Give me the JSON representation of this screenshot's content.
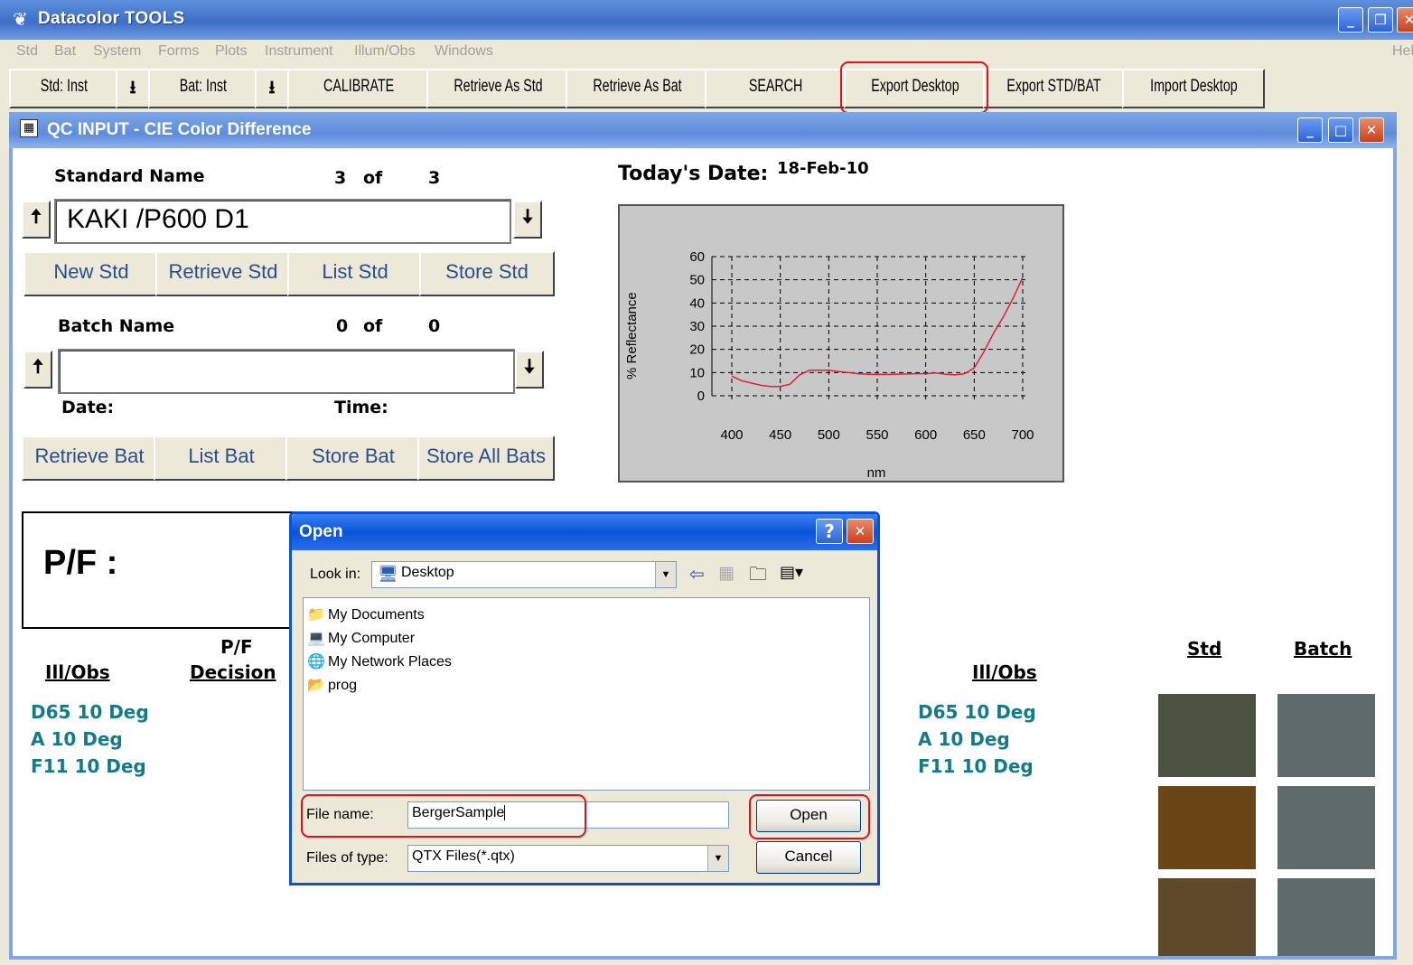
{
  "app": {
    "title": "Datacolor TOOLS",
    "help_fragment": "Hel"
  },
  "menu": [
    "Std",
    "Bat",
    "System",
    "Forms",
    "Plots",
    "Instrument",
    "Illum/Obs",
    "Windows"
  ],
  "toolbar": {
    "std_inst": "Std: Inst",
    "bat_inst": "Bat: Inst",
    "calibrate": "CALIBRATE",
    "retrieve_as_std": "Retrieve As Std",
    "retrieve_as_bat": "Retrieve As Bat",
    "search": "SEARCH",
    "export_desktop": "Export Desktop",
    "export_std_bat": "Export STD/BAT",
    "import_desktop": "Import Desktop"
  },
  "window": {
    "title": "QC INPUT - CIE Color Difference"
  },
  "standard": {
    "label": "Standard Name",
    "index": "3",
    "of": "of",
    "total": "3",
    "value": "KAKI /P600 D1",
    "buttons": [
      "New Std",
      "Retrieve Std",
      "List Std",
      "Store Std"
    ]
  },
  "batch": {
    "label": "Batch Name",
    "index": "0",
    "of": "of",
    "total": "0",
    "value": "",
    "date_label": "Date:",
    "time_label": "Time:",
    "buttons": [
      "Retrieve Bat",
      "List Bat",
      "Store Bat",
      "Store All Bats"
    ]
  },
  "today": {
    "label": "Today's Date:",
    "value": "18-Feb-10"
  },
  "pf": {
    "label": "P/F :"
  },
  "left_table": {
    "col1": "Ill/Obs",
    "col2_line1": "P/F",
    "col2_line2": "Decision",
    "rows": [
      "D65 10 Deg",
      "A 10 Deg",
      "F11 10 Deg"
    ]
  },
  "right_table": {
    "col1": "Ill/Obs",
    "std": "Std",
    "batch": "Batch",
    "rows": [
      "D65 10 Deg",
      "A 10 Deg",
      "F11 10 Deg"
    ]
  },
  "swatches": {
    "std": [
      "#4b5240",
      "#6a4616",
      "#5e4a2a"
    ],
    "batch": [
      "#5f6b6b",
      "#5f6b6b",
      "#5f6b6b"
    ]
  },
  "dialog": {
    "title": "Open",
    "look_in_label": "Look in:",
    "look_in_value": "Desktop",
    "items": [
      "My Documents",
      "My Computer",
      "My Network Places",
      "prog"
    ],
    "file_name_label": "File name:",
    "file_name_value": "BergerSample",
    "files_of_type_label": "Files of type:",
    "files_of_type_value": "QTX Files(*.qtx)",
    "open": "Open",
    "cancel": "Cancel",
    "help": "?",
    "close": "✕"
  },
  "chart_data": {
    "type": "line",
    "xlabel": "nm",
    "ylabel": "% Reflectance",
    "xlim": [
      400,
      700
    ],
    "ylim": [
      0,
      60
    ],
    "xticks": [
      400,
      450,
      500,
      550,
      600,
      650,
      700
    ],
    "yticks": [
      0,
      10,
      20,
      30,
      40,
      50,
      60
    ],
    "grid": true,
    "series": [
      {
        "color": "#e0203a",
        "x": [
          400,
          410,
          420,
          430,
          440,
          450,
          460,
          470,
          480,
          490,
          500,
          510,
          520,
          530,
          540,
          550,
          560,
          570,
          580,
          590,
          600,
          610,
          620,
          630,
          640,
          650,
          660,
          670,
          680,
          690,
          700
        ],
        "y": [
          8.5,
          6.5,
          5.5,
          4.5,
          4,
          4,
          5,
          9,
          11,
          11,
          11,
          10.5,
          10,
          9.5,
          9.3,
          9.2,
          9.2,
          9.3,
          9.4,
          9.5,
          9.5,
          9.8,
          9.3,
          9,
          9.5,
          12,
          19,
          27,
          34,
          42,
          51
        ]
      }
    ]
  }
}
